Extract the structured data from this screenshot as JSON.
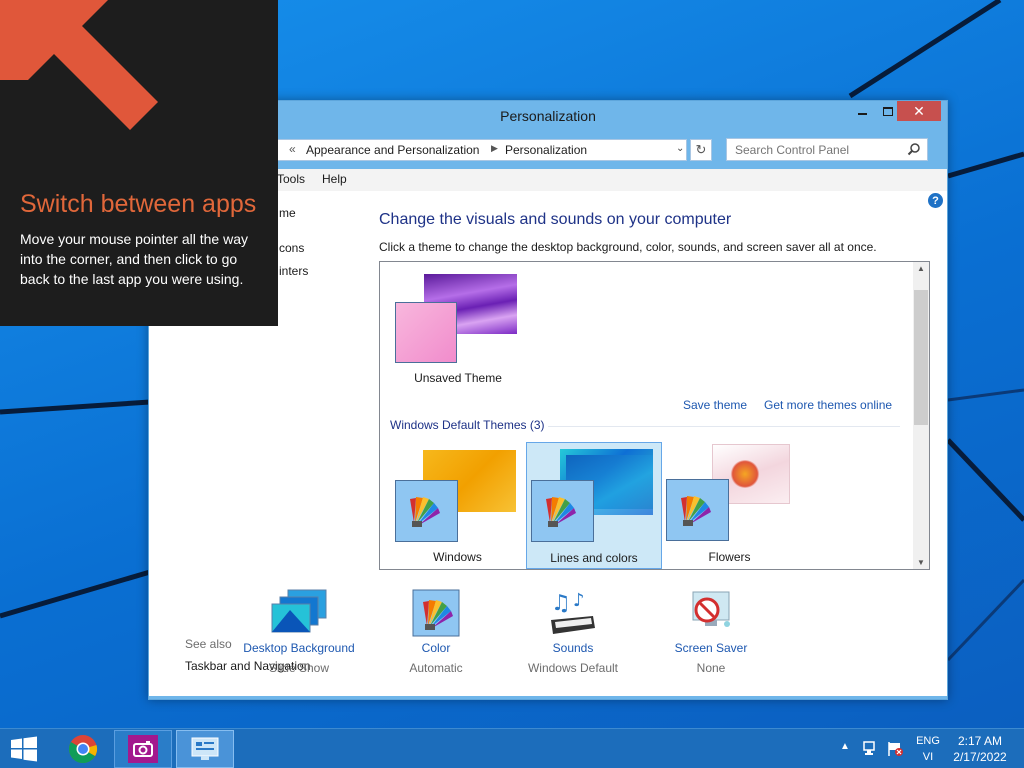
{
  "tip": {
    "title": "Switch between apps",
    "body": "Move your mouse pointer all the way into the corner, and then click to go back to the last app you were using."
  },
  "window": {
    "title": "Personalization",
    "address": {
      "separator": "«",
      "crumbs": [
        "Appearance and Personalization",
        "Personalization"
      ]
    },
    "search": {
      "placeholder": "Search Control Panel"
    },
    "menu": {
      "tools": "Tools",
      "help": "Help"
    },
    "left_nav": {
      "items": [
        "me",
        "cons",
        "inters"
      ],
      "see_also": "See also",
      "taskbar_link": "Taskbar and Navigation"
    },
    "heading": "Change the visuals and sounds on your computer",
    "subheading": "Click a theme to change the desktop background, color, sounds, and screen saver all at once.",
    "my_themes": {
      "unsaved_label": "Unsaved Theme"
    },
    "links": {
      "save_theme": "Save theme",
      "more_themes": "Get more themes online"
    },
    "default_group": {
      "title": "Windows Default Themes (3)",
      "themes": [
        "Windows",
        "Lines and colors",
        "Flowers"
      ]
    },
    "bottom": {
      "desktop": {
        "label": "Desktop Background",
        "value": "Slide Show"
      },
      "color": {
        "label": "Color",
        "value": "Automatic"
      },
      "sounds": {
        "label": "Sounds",
        "value": "Windows Default"
      },
      "saver": {
        "label": "Screen Saver",
        "value": "None"
      }
    }
  },
  "taskbar": {
    "lang_line1": "ENG",
    "lang_line2": "VI",
    "time": "2:17 AM",
    "date": "2/17/2022"
  },
  "colors": {
    "accent": "#1e3287",
    "link": "#1e58b0",
    "tip_title": "#e0673a",
    "close_button": "#c7504e",
    "taskbar": "#1c6dbb"
  }
}
